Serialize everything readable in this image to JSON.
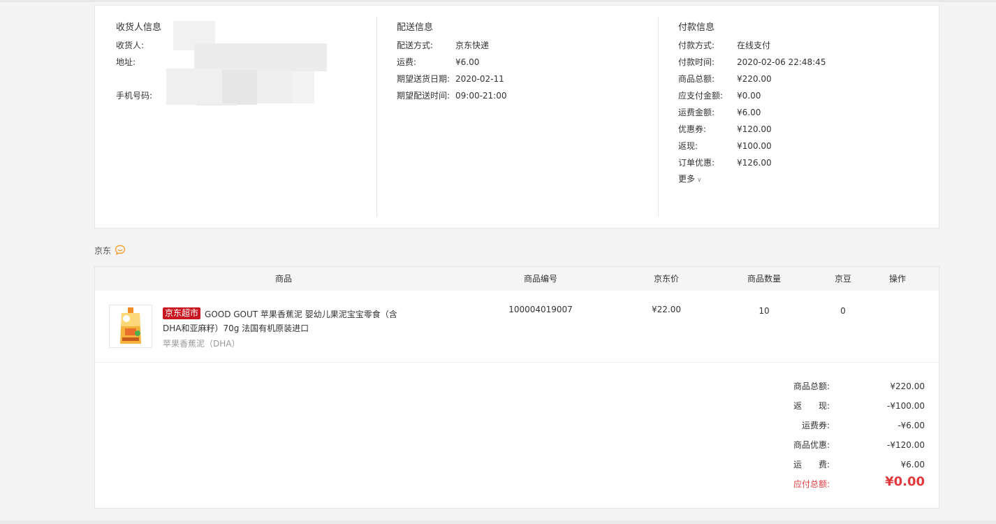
{
  "receiver": {
    "title": "收货人信息",
    "name_label": "收货人:",
    "address_label": "地址:",
    "phone_label": "手机号码:"
  },
  "delivery": {
    "title": "配送信息",
    "rows": [
      {
        "label": "配送方式:",
        "value": "京东快递"
      },
      {
        "label": "运费:",
        "value": "¥6.00"
      },
      {
        "label": "期望送货日期:",
        "value": "2020-02-11"
      },
      {
        "label": "期望配送时间:",
        "value": "09:00-21:00"
      }
    ]
  },
  "payment": {
    "title": "付款信息",
    "rows": [
      {
        "label": "付款方式:",
        "value": "在线支付"
      },
      {
        "label": "付款时间:",
        "value": "2020-02-06 22:48:45"
      },
      {
        "label": "商品总额:",
        "value": "¥220.00"
      },
      {
        "label": "应支付金额:",
        "value": "¥0.00"
      },
      {
        "label": "运费金额:",
        "value": "¥6.00"
      },
      {
        "label": "优惠券:",
        "value": "¥120.00"
      },
      {
        "label": "返现:",
        "value": "¥100.00"
      },
      {
        "label": "订单优惠:",
        "value": "¥126.00"
      }
    ],
    "more_label": "更多",
    "more_icon": "chevron-down-icon"
  },
  "shop": {
    "name": "京东",
    "icon": "chat-bubble-icon",
    "icon_color": "#f0a030"
  },
  "table": {
    "headers": [
      "商品",
      "商品编号",
      "京东价",
      "商品数量",
      "京豆",
      "操作"
    ],
    "item": {
      "tag": "京东超市",
      "name": "GOOD GOUT 苹果香蕉泥 婴幼儿果泥宝宝零食（含DHA和亚麻籽）70g 法国有机原装进口",
      "spec": "苹果香蕉泥（DHA）",
      "sku": "100004019007",
      "price": "¥22.00",
      "quantity": "10",
      "beans": "0"
    }
  },
  "totals": [
    {
      "label": "商品总额:",
      "value": "¥220.00"
    },
    {
      "label": "返　　现:",
      "value": "-¥100.00"
    },
    {
      "label": "运费券:",
      "value": "-¥6.00"
    },
    {
      "label": "商品优惠:",
      "value": "-¥120.00"
    },
    {
      "label": "运　　费:",
      "value": "¥6.00"
    },
    {
      "label": "应付总额:",
      "value": "¥0.00"
    }
  ],
  "colors": {
    "accent_red": "#e4393c",
    "tag_red": "#c81623"
  }
}
